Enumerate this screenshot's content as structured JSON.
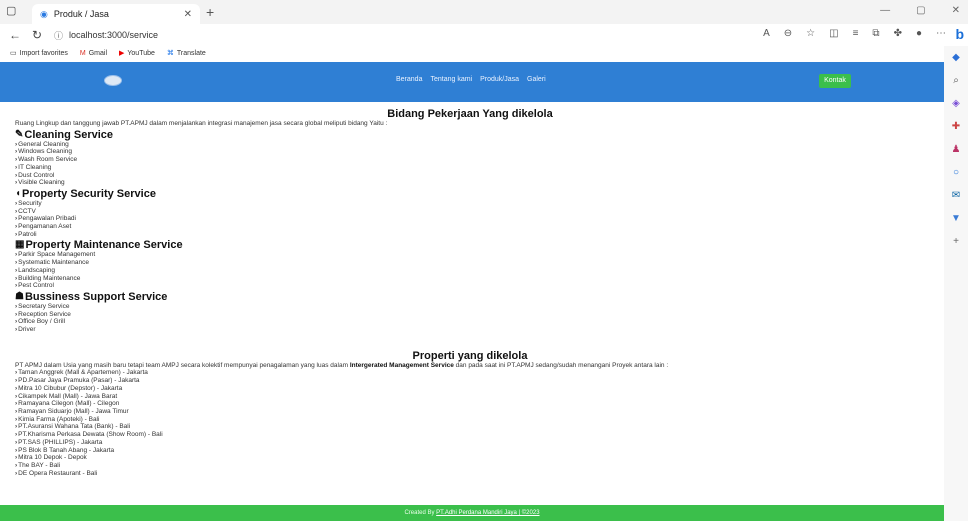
{
  "browser": {
    "tab_title": "Produk / Jasa",
    "url": "localhost:3000/service",
    "bookmarks": [
      "Import favorites",
      "Gmail",
      "YouTube",
      "Translate"
    ]
  },
  "navbar": {
    "menu": [
      "Beranda",
      "Tentang kami",
      "Produk/Jasa",
      "Galeri"
    ],
    "contact_button": "Kontak"
  },
  "services": {
    "title": "Bidang Pekerjaan Yang dikelola",
    "intro": "Ruang Lingkup dan tanggung jawab PT.APMJ dalam menjalankan integrasi manajemen jasa secara global meliputi bidang Yaitu :",
    "groups": [
      {
        "name": "Cleaning Service",
        "icon": "broom-icon",
        "items": [
          "General Cleaning",
          "Windows Cleaning",
          "Wash Room Service",
          "IT Cleaning",
          "Dust Control",
          "Visible Cleaning"
        ]
      },
      {
        "name": "Property Security Service",
        "icon": "shield-icon",
        "items": [
          "Security",
          "CCTV",
          "Pengawalan Pribadi",
          "Pengamanan Aset",
          "Patroli"
        ]
      },
      {
        "name": "Property Maintenance Service",
        "icon": "building-icon",
        "items": [
          "Parkir Space Management",
          "Systematic Maintenance",
          "Landscaping",
          "Building Maintenance",
          "Pest Control"
        ]
      },
      {
        "name": "Bussiness Support Service",
        "icon": "people-icon",
        "items": [
          "Secretary Service",
          "Reception Service",
          "Office Boy / Grill",
          "Driver"
        ]
      }
    ]
  },
  "properties": {
    "title": "Properti yang dikelola",
    "intro_before": "PT APMJ dalam Usia yang masih baru tetapi team AMPJ secara kolektif mempunyai penagalaman yang luas dalam ",
    "intro_bold": "Intergerated Management Service",
    "intro_after": " dan pada saat ini PT.APMJ sedang/sudah menangani Proyek antara lain :",
    "items": [
      "Taman Anggrek (Mall & Apartemen) - Jakarta",
      "PD.Pasar Jaya Pramuka (Pasar) - Jakarta",
      "Mitra 10 Cibubur (Depstor) - Jakarta",
      "Cikampek Mall (Mall) - Jawa Barat",
      "Ramayana Cilegon (Mall) - Cilegon",
      "Ramayan Siduarjo (Mall) - Jawa Timur",
      "Kimia Farma (Apoteki) - Bali",
      "PT.Asuransi Wahana Tata (Bank) - Bali",
      "PT.Kharisma Perkasa Dewata (Show Room) - Bali",
      "PT.SAS (PHILLIPS) - Jakarta",
      "PS Blok B Tanah Abang - Jakarta",
      "Mitra 10 Depok - Depok",
      "The BAY - Bali",
      "DE Opera Restaurant - Bali"
    ]
  },
  "footer": {
    "prefix": "Created By ",
    "link": "PT.Adhi Perdana Mandiri Jaya | ©2023"
  }
}
